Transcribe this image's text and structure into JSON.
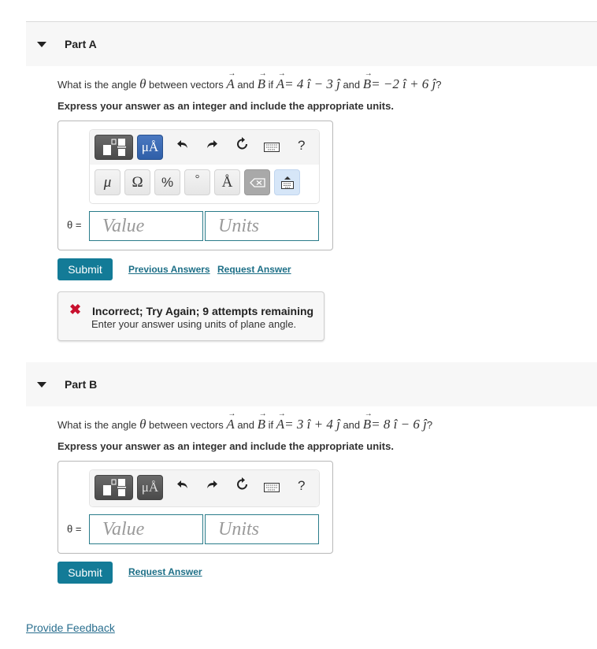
{
  "parts": [
    {
      "title": "Part A",
      "question": {
        "prefix": "What is the angle ",
        "theta": "θ",
        "between": " between vectors ",
        "vecA": "A",
        "and1": " and ",
        "vecB": "B",
        "if": " if ",
        "eqA": "= 4 ",
        "i1": "î",
        "opA": " − 3 ",
        "j1": "ĵ",
        "and2": " and ",
        "eqB": "= −2 ",
        "i2": "î",
        "opB": " + 6 ",
        "j2": "ĵ",
        "end": "?"
      },
      "instruction": "Express your answer as an integer and include the appropriate units.",
      "toolbar": {
        "units_label": "μÅ",
        "undo": "↶",
        "redo": "↷",
        "reset": "↻",
        "keyboard": "⌨",
        "help": "?",
        "symbols": [
          "μ",
          "Ω",
          "%",
          "°",
          "Å"
        ]
      },
      "answer_label": "θ =",
      "value_placeholder": "Value",
      "units_placeholder": "Units",
      "submit_label": "Submit",
      "previous_answers_label": "Previous Answers",
      "request_answer_label": "Request Answer",
      "feedback": {
        "title": "Incorrect; Try Again; 9 attempts remaining",
        "message": "Enter your answer using units of plane angle.",
        "status_color": "#c8102e"
      }
    },
    {
      "title": "Part B",
      "question": {
        "prefix": "What is the angle ",
        "theta": "θ",
        "between": " between vectors ",
        "vecA": "A",
        "and1": " and ",
        "vecB": "B",
        "if": " if ",
        "eqA": "= 3 ",
        "i1": "î",
        "opA": " + 4 ",
        "j1": "ĵ",
        "and2": " and ",
        "eqB": "= 8 ",
        "i2": "î",
        "opB": " − 6 ",
        "j2": "ĵ",
        "end": "?"
      },
      "instruction": "Express your answer as an integer and include the appropriate units.",
      "toolbar": {
        "units_label": "μÅ",
        "undo": "↶",
        "redo": "↷",
        "reset": "↻",
        "keyboard": "⌨",
        "help": "?"
      },
      "answer_label": "θ =",
      "value_placeholder": "Value",
      "units_placeholder": "Units",
      "submit_label": "Submit",
      "request_answer_label": "Request Answer"
    }
  ],
  "footer": {
    "provide_feedback_label": "Provide Feedback"
  },
  "colors": {
    "accent": "#137b97",
    "link": "#1d6f87",
    "error": "#c8102e",
    "input_border": "#2a7c8a"
  }
}
